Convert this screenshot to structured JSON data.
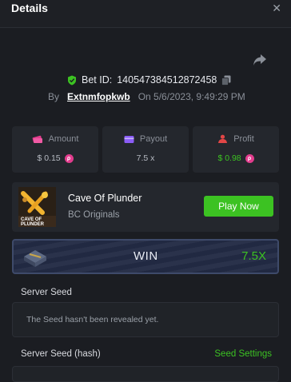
{
  "header": {
    "title": "Details",
    "close_glyph": "✕"
  },
  "bet": {
    "id_label": "Bet ID:",
    "id": "140547384512872458",
    "by_label": "By",
    "user": "Extnmfopkwb",
    "on_label": "On",
    "datetime": "5/6/2023, 9:49:29 PM"
  },
  "stats": {
    "amount": {
      "label": "Amount",
      "value": "$ 0.15",
      "icon": "money-icon"
    },
    "payout": {
      "label": "Payout",
      "value": "7.5 x",
      "icon": "wallet-icon"
    },
    "profit": {
      "label": "Profit",
      "value": "$ 0.98",
      "icon": "profit-icon"
    },
    "coin_glyph": "ρ"
  },
  "game": {
    "name": "Cave Of Plunder",
    "provider": "BC Originals",
    "thumb_text_1": "CAVE OF",
    "thumb_text_2": "PLUNDER",
    "play_label": "Play Now"
  },
  "result": {
    "outcome": "WIN",
    "multiplier": "7.5X"
  },
  "seeds": {
    "server_seed_label": "Server Seed",
    "server_seed_value": "The Seed hasn't been revealed yet.",
    "server_hash_label": "Server Seed (hash)",
    "seed_settings_label": "Seed Settings"
  },
  "colors": {
    "accent_green": "#3cc222",
    "coin_pink": "#e23c8d",
    "background": "#1b1d22",
    "card": "#24272d"
  }
}
